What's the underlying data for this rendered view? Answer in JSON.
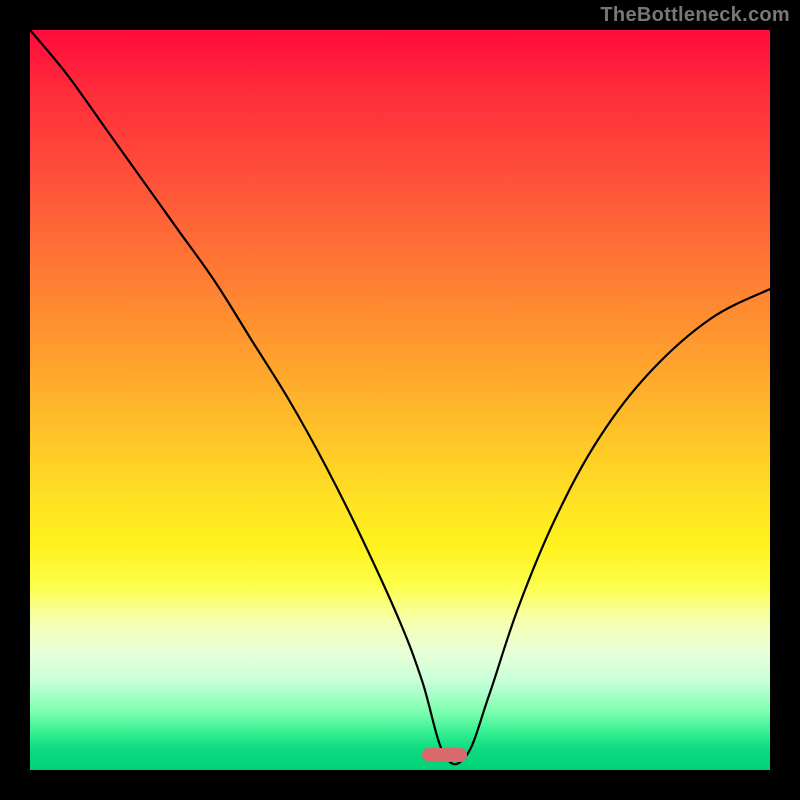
{
  "watermark": "TheBottleneck.com",
  "colors": {
    "frame_bg": "#000000",
    "curve_stroke": "#000000",
    "marker_fill": "#d86a6d",
    "watermark_color": "#777777"
  },
  "chart_data": {
    "type": "line",
    "title": "",
    "xlabel": "",
    "ylabel": "",
    "xlim": [
      0,
      100
    ],
    "ylim": [
      0,
      100
    ],
    "grid": false,
    "legend": false,
    "annotations": [],
    "marker": {
      "x_center_pct": 56,
      "width_pct": 6,
      "y_pct": 2
    },
    "series": [
      {
        "name": "bottleneck-curve",
        "x": [
          0,
          5,
          10,
          15,
          20,
          25,
          30,
          35,
          40,
          45,
          50,
          53,
          56,
          59,
          62,
          66,
          71,
          77,
          84,
          92,
          100
        ],
        "values": [
          100,
          94,
          87,
          80,
          73,
          66,
          58,
          50,
          41,
          31,
          20,
          12,
          2,
          2,
          10,
          22,
          34,
          45,
          54,
          61,
          65
        ]
      }
    ]
  }
}
